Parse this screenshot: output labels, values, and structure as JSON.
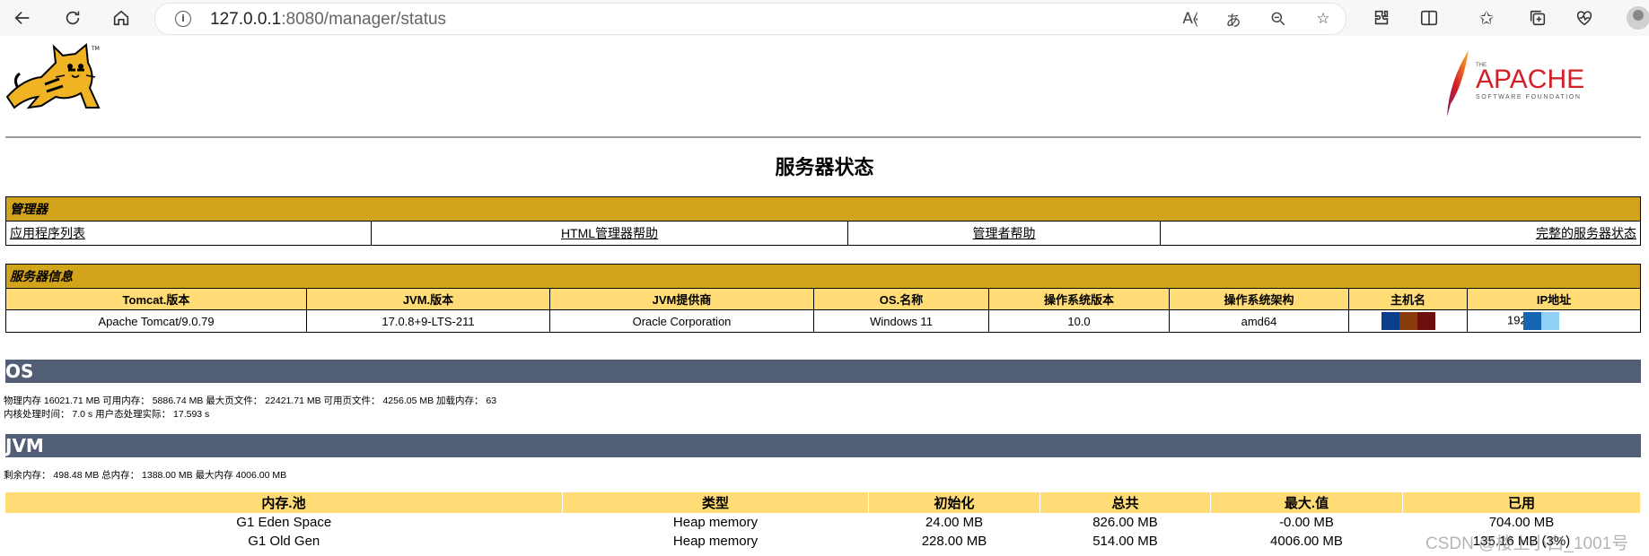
{
  "browser": {
    "url_host": "127.0.0.1",
    "url_rest": ":8080/manager/status"
  },
  "page": {
    "title": "服务器状态",
    "manager_section": {
      "header": "管理器",
      "links": [
        "应用程序列表",
        "HTML管理器帮助",
        "管理者帮助",
        "完整的服务器状态"
      ]
    },
    "server_info": {
      "header": "服务器信息",
      "columns": [
        "Tomcat.版本",
        "JVM.版本",
        "JVM提供商",
        "OS.名称",
        "操作系统版本",
        "操作系统架构",
        "主机名",
        "IP地址"
      ],
      "values": [
        "Apache Tomcat/9.0.79",
        "17.0.8+9-LTS-211",
        "Oracle Corporation",
        "Windows 11",
        "10.0",
        "amd64",
        "",
        "192"
      ]
    },
    "os_section": {
      "title": "OS",
      "line1": "物理内存 16021.71 MB 可用内存： 5886.74 MB 最大页文件： 22421.71 MB 可用页文件： 4256.05 MB 加载内存： 63",
      "line2": "内核处理时间： 7.0 s 用户态处理实际： 17.593 s"
    },
    "jvm_section": {
      "title": "JVM",
      "line1": "剩余内存： 498.48 MB 总内存： 1388.00 MB 最大内存 4006.00 MB"
    },
    "memory_table": {
      "columns": [
        "内存.池",
        "类型",
        "初始化",
        "总共",
        "最大.值",
        "已用"
      ],
      "rows": [
        [
          "G1 Eden Space",
          "Heap memory",
          "24.00 MB",
          "826.00 MB",
          "-0.00 MB",
          "704.00 MB"
        ],
        [
          "G1 Old Gen",
          "Heap memory",
          "228.00 MB",
          "514.00 MB",
          "4006.00 MB",
          "135.16 MB (3%)"
        ]
      ]
    },
    "watermark": "CSDN @楼上小白_1001号"
  },
  "logos": {
    "apache_small": "THE",
    "apache_main": "APACHE",
    "apache_sub": "SOFTWARE FOUNDATION"
  },
  "colors": {
    "gold_header": "#d2a41c",
    "column_header": "#ffdc75",
    "section_bar": "#525d76"
  }
}
